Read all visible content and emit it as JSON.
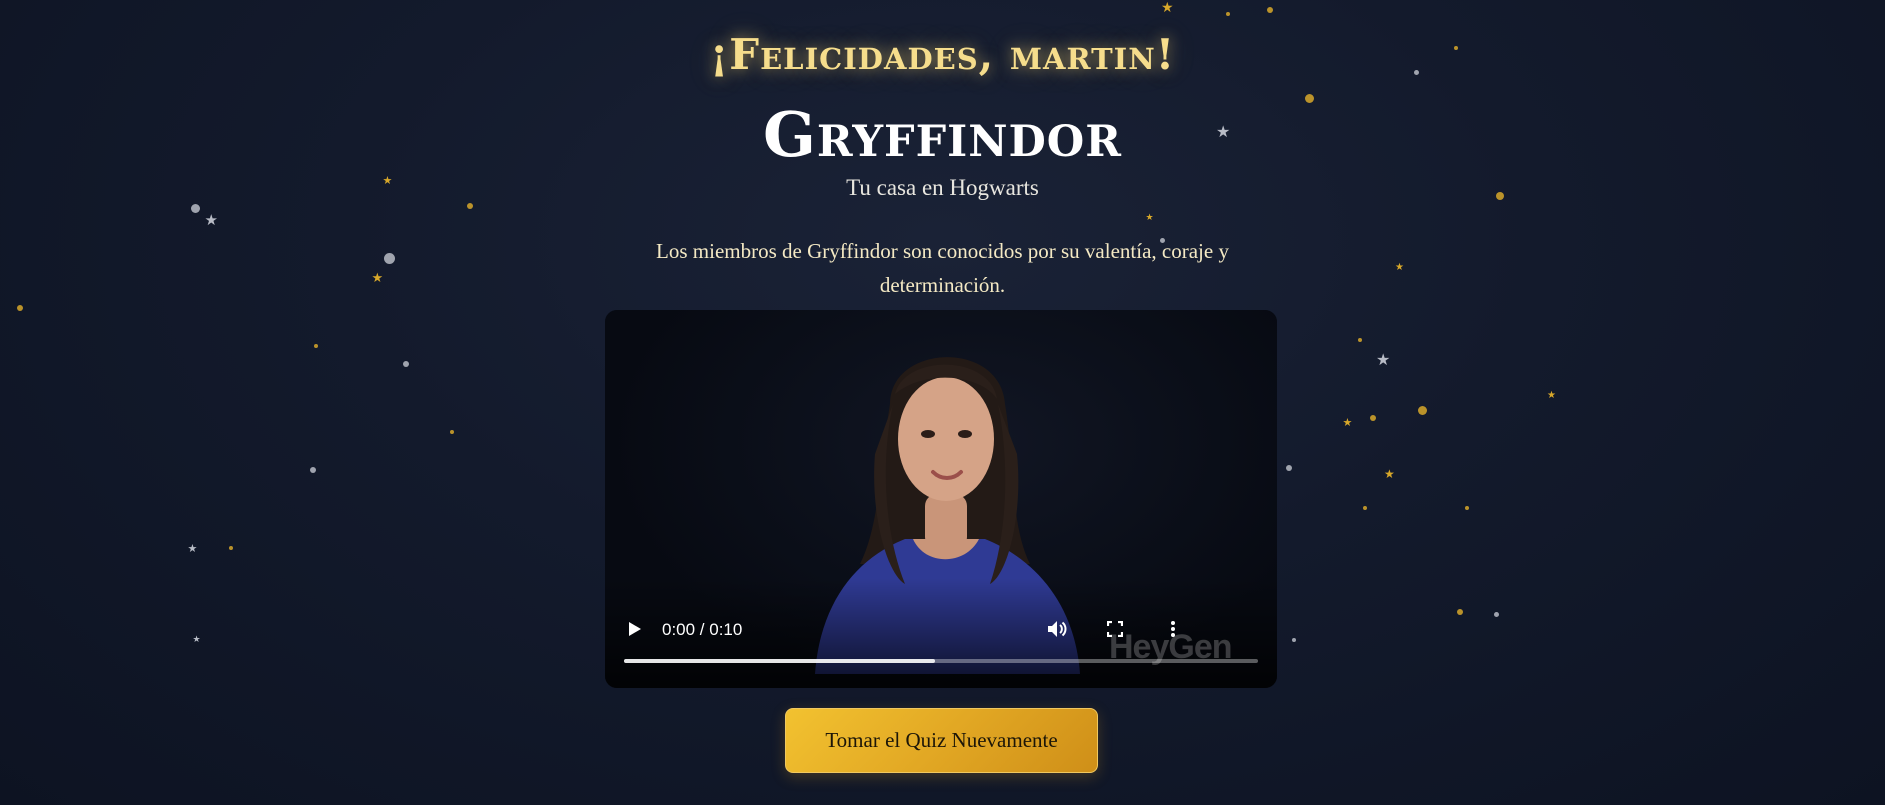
{
  "header": {
    "greeting": "¡Felicidades, martin!",
    "house_name": "Gryffindor",
    "subtitle": "Tu casa en Hogwarts"
  },
  "main": {
    "description": "Los miembros de Gryffindor son conocidos por su valentía, coraje y determinación."
  },
  "video": {
    "time_display": "0:00 / 0:10",
    "progress_fraction": 0.49,
    "watermark": "HeyGen",
    "controls": {
      "play_icon": "play-icon",
      "volume_icon": "volume-icon",
      "fullscreen_icon": "fullscreen-icon",
      "more_icon": "more-options-icon"
    }
  },
  "actions": {
    "retake_label": "Tomar el Quiz Nuevamente"
  },
  "colors": {
    "background": "#131a2c",
    "greeting_gold": "#f6dd8c",
    "button_gold": "#e2a824",
    "description_text": "#f4e9c4",
    "star_gold": "#d8a82a",
    "star_silver": "#b8bcc6"
  }
}
